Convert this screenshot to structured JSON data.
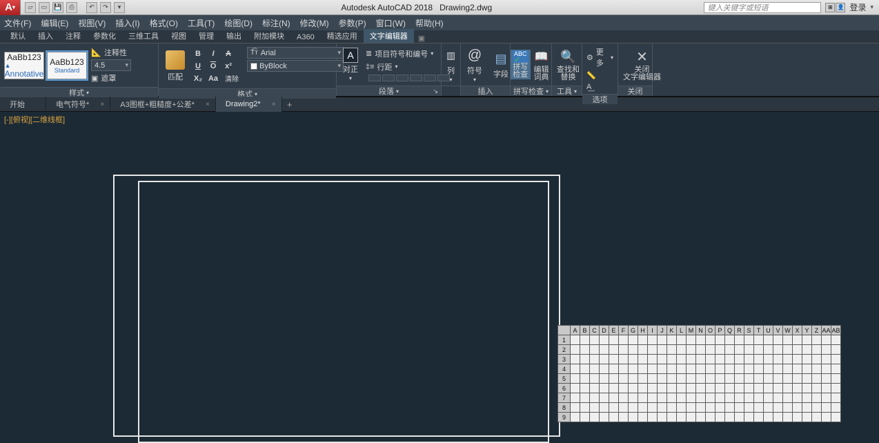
{
  "title": {
    "app": "Autodesk AutoCAD 2018",
    "doc": "Drawing2.dwg"
  },
  "search_placeholder": "键入关键字或短语",
  "login_label": "登录",
  "menus": [
    "文件(F)",
    "编辑(E)",
    "视图(V)",
    "插入(I)",
    "格式(O)",
    "工具(T)",
    "绘图(D)",
    "标注(N)",
    "修改(M)",
    "参数(P)",
    "窗口(W)",
    "帮助(H)"
  ],
  "ribbon_tabs": [
    "默认",
    "插入",
    "注释",
    "参数化",
    "三维工具",
    "视图",
    "管理",
    "输出",
    "附加模块",
    "A360",
    "精选应用",
    "文字编辑器"
  ],
  "active_ribbon_tab": 11,
  "styles": {
    "sample": "AaBb123",
    "annotative": "Annotative",
    "standard": "Standard",
    "annotative_label": "注释性",
    "font_size": "4.5",
    "mask_label": "遮罩",
    "panel": "样式"
  },
  "format": {
    "match": "匹配",
    "font": "Arial",
    "layer": "ByBlock",
    "panel": "格式",
    "bold": "B",
    "italic": "I",
    "strike": "A",
    "underline": "U",
    "overline": "O",
    "super": "x²",
    "clear": "清除"
  },
  "align": {
    "label": "对正",
    "panel": "段落",
    "bullets": "项目符号和编号",
    "linespace": "行距"
  },
  "columns": {
    "label": "列"
  },
  "insert": {
    "panel": "插入",
    "symbol": "符号",
    "field": "字段",
    "at": "@"
  },
  "spell": {
    "panel": "拼写检查",
    "spell": "拼写\n检查",
    "dict": "编辑\n词典",
    "abc": "ABC"
  },
  "tools": {
    "panel": "工具",
    "find": "查找和\n替换"
  },
  "options": {
    "panel": "选项",
    "more": "更多"
  },
  "close": {
    "panel": "关闭",
    "close": "关闭\n文字编辑器"
  },
  "file_tabs": [
    "开始",
    "电气符号*",
    "A3图框+粗糙度+公差*",
    "Drawing2*"
  ],
  "active_file_tab": 3,
  "viewport_label": "[-][俯视][二维线框]",
  "sheet": {
    "cols": [
      "A",
      "B",
      "C",
      "D",
      "E",
      "F",
      "G",
      "H",
      "I",
      "J",
      "K",
      "L",
      "M",
      "N",
      "O",
      "P",
      "Q",
      "R",
      "S",
      "T",
      "U",
      "V",
      "W",
      "X",
      "Y",
      "Z",
      "AA",
      "AB"
    ],
    "rows": [
      "1",
      "2",
      "3",
      "4",
      "5",
      "6",
      "7",
      "8",
      "9"
    ]
  }
}
